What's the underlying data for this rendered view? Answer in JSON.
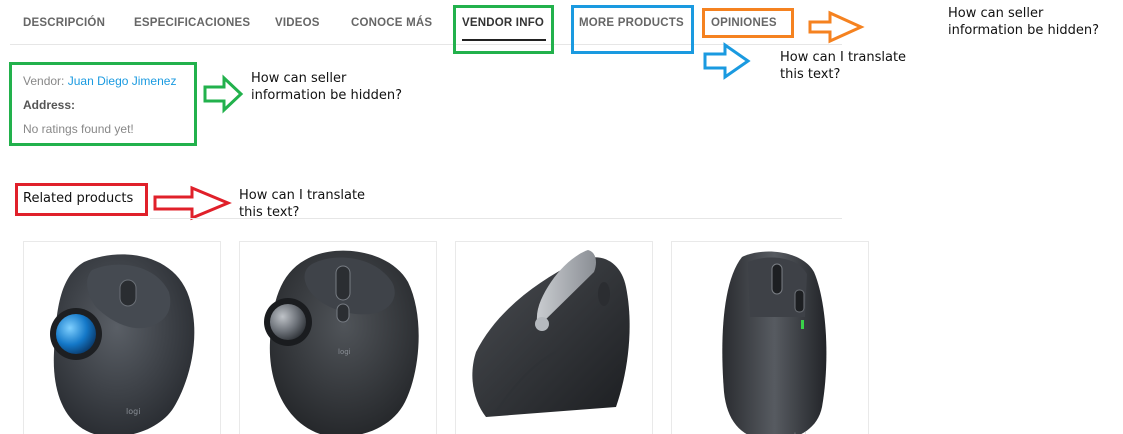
{
  "tabs": [
    {
      "label": "DESCRIPCIÓN"
    },
    {
      "label": "ESPECIFICACIONES"
    },
    {
      "label": "VIDEOS"
    },
    {
      "label": "CONOCE MÁS"
    },
    {
      "label": "VENDOR INFO",
      "active": true
    },
    {
      "label": "MORE PRODUCTS"
    },
    {
      "label": "OPINIONES"
    }
  ],
  "vendor_info": {
    "vendor_label": "Vendor:",
    "vendor_name": "Juan Diego Jimenez",
    "address_label": "Address:",
    "ratings_text": "No ratings found yet!"
  },
  "related": {
    "title": "Related products",
    "products": [
      {
        "icon": "trackball-mouse-image"
      },
      {
        "icon": "ergonomic-trackball-mouse-image"
      },
      {
        "icon": "vertical-mouse-image"
      },
      {
        "icon": "wireless-mouse-image"
      }
    ]
  },
  "annotations": {
    "green_note": {
      "line1": "How can seller",
      "line2": "information be hidden?"
    },
    "blue_note": {
      "line1": "How can I translate",
      "line2": "this text?"
    },
    "orange_note": {
      "line1": "How can seller",
      "line2": "information be hidden?"
    },
    "red_note": {
      "line1": "How can I translate",
      "line2": "this text?"
    }
  },
  "colors": {
    "green": "#22b14c",
    "blue": "#1a9ae0",
    "orange": "#f58220",
    "red": "#e0202a",
    "link": "#1a9ae0"
  }
}
